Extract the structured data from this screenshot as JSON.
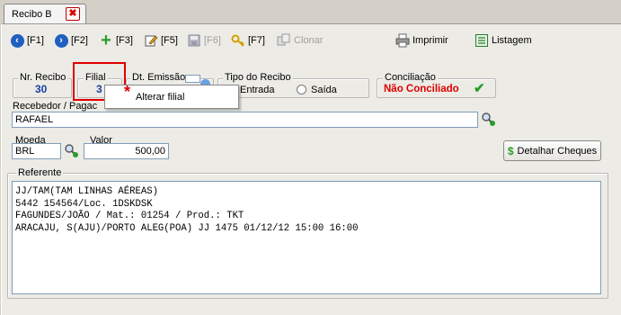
{
  "tab": {
    "label": "Recibo B"
  },
  "toolbar": {
    "f1": "[F1]",
    "f2": "[F2]",
    "f3": "[F3]",
    "f5": "[F5]",
    "f6": "[F6]",
    "f7": "[F7]",
    "clonar": "Clonar",
    "imprimir": "Imprimir",
    "listagem": "Listagem"
  },
  "header": {
    "nr_recibo_label": "Nr. Recibo",
    "nr_recibo_value": "30",
    "filial_label": "Filial",
    "filial_value": "3",
    "dt_emissao_label": "Dt. Emissão:",
    "tipo_label": "Tipo do Recibo",
    "tipo_options": [
      "Entrada",
      "Saída"
    ],
    "tipo_selected": "Entrada",
    "conciliacao_label": "Conciliação",
    "conciliacao_value": "Não Conciliado"
  },
  "context_menu": {
    "item": "Alterar filial"
  },
  "recebedor": {
    "label": "Recebedor / Pagac",
    "value": "RAFAEL"
  },
  "moeda": {
    "label": "Moeda",
    "value": "BRL"
  },
  "valor": {
    "label": "Valor",
    "value": "500,00"
  },
  "detalhar_button": "Detalhar Cheques",
  "referente": {
    "label": "Referente",
    "lines": [
      "JJ/TAM(TAM LINHAS AÉREAS)",
      "5442 154564/Loc. 1DSKDSK",
      "FAGUNDES/JOÃO / Mat.: 01254 / Prod.: TKT",
      "ARACAJU, S(AJU)/PORTO ALEG(POA) JJ 1475 01/12/12 15:00 16:00"
    ]
  },
  "colors": {
    "accent_blue": "#1f5fbf",
    "status_red": "#e00000",
    "highlight_red": "#e00000"
  }
}
